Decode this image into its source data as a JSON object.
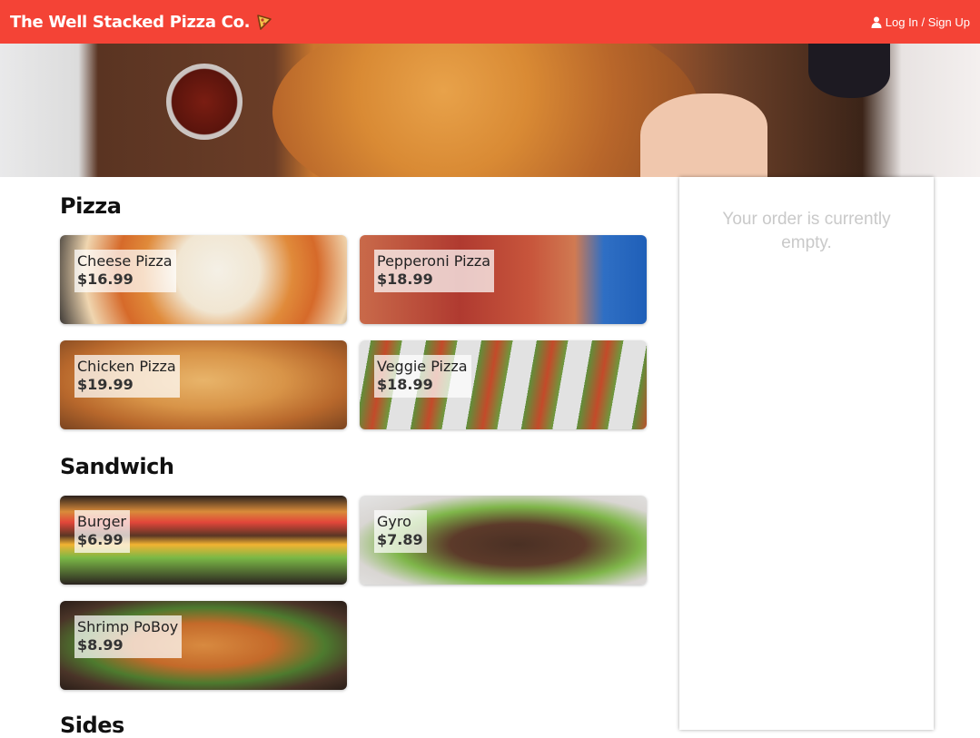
{
  "header": {
    "brand": "The Well Stacked Pizza Co.",
    "login_label": "Log In / Sign Up",
    "accent_color": "#f44336"
  },
  "sections": [
    {
      "title": "Pizza",
      "items": [
        {
          "name": "Cheese Pizza",
          "price": "$16.99"
        },
        {
          "name": "Pepperoni Pizza",
          "price": "$18.99"
        },
        {
          "name": "Chicken Pizza",
          "price": "$19.99"
        },
        {
          "name": "Veggie Pizza",
          "price": "$18.99"
        }
      ]
    },
    {
      "title": "Sandwich",
      "items": [
        {
          "name": "Burger",
          "price": "$6.99"
        },
        {
          "name": "Gyro",
          "price": "$7.89"
        },
        {
          "name": "Shrimp PoBoy",
          "price": "$8.99"
        }
      ]
    },
    {
      "title": "Sides",
      "items": []
    }
  ],
  "order": {
    "empty_message": "Your order is currently empty."
  }
}
